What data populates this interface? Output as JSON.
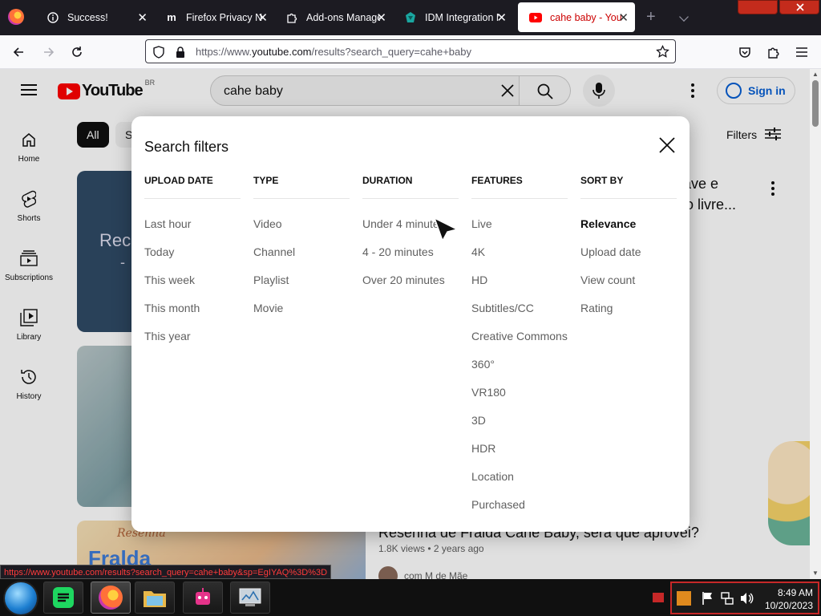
{
  "browser": {
    "tabs": [
      {
        "title": "Success!",
        "icon": "globe-icon",
        "active": false
      },
      {
        "title": "Firefox Privacy Ne",
        "icon": "mozilla-m-icon",
        "active": false
      },
      {
        "title": "Add-ons Manage",
        "icon": "puzzle-icon",
        "active": false
      },
      {
        "title": "IDM Integration M",
        "icon": "idm-icon",
        "active": false
      },
      {
        "title": "cahe baby - YouT",
        "icon": "youtube-icon",
        "active": true
      }
    ],
    "url_prefix": "https://www.",
    "url_domain": "youtube.com",
    "url_path": "/results?search_query=cahe+baby",
    "status_url": "https://www.youtube.com/results?search_query=cahe+baby&sp=EgIYAQ%3D%3D"
  },
  "youtube": {
    "logo_text": "YouTube",
    "country_code": "BR",
    "search_query": "cahe baby",
    "sign_in": "Sign in",
    "sidebar": [
      {
        "label": "Home",
        "icon": "home-icon"
      },
      {
        "label": "Shorts",
        "icon": "shorts-icon"
      },
      {
        "label": "Subscriptions",
        "icon": "subscriptions-icon"
      },
      {
        "label": "Library",
        "icon": "library-icon"
      },
      {
        "label": "History",
        "icon": "history-icon"
      }
    ],
    "chips": [
      "All",
      "S"
    ],
    "filters_label": "Filters",
    "results": {
      "r1_thumb_text": "Rec",
      "r1_thumb_text2": "-",
      "r1_title_line1": "ave e",
      "r1_title_line2": "uto livre...",
      "r3_thumb_line1": "Resenha",
      "r3_thumb_line2": "Fralda",
      "r3_title": "Resenha de Fralda Cahe Baby, será que aprovei?",
      "r3_meta": "1.8K views • 2 years ago",
      "r3_channel": "com M de Mãe"
    }
  },
  "modal": {
    "title": "Search filters",
    "columns": [
      {
        "heading": "UPLOAD DATE",
        "options": [
          "Last hour",
          "Today",
          "This week",
          "This month",
          "This year"
        ],
        "selected": null
      },
      {
        "heading": "TYPE",
        "options": [
          "Video",
          "Channel",
          "Playlist",
          "Movie"
        ],
        "selected": null
      },
      {
        "heading": "DURATION",
        "options": [
          "Under 4 minutes",
          "4 - 20 minutes",
          "Over 20 minutes"
        ],
        "selected": null
      },
      {
        "heading": "FEATURES",
        "options": [
          "Live",
          "4K",
          "HD",
          "Subtitles/CC",
          "Creative Commons",
          "360°",
          "VR180",
          "3D",
          "HDR",
          "Location",
          "Purchased"
        ],
        "selected": null
      },
      {
        "heading": "SORT BY",
        "options": [
          "Relevance",
          "Upload date",
          "View count",
          "Rating"
        ],
        "selected": "Relevance"
      }
    ]
  },
  "taskbar": {
    "apps": [
      "spotify-like-app-icon",
      "firefox-icon",
      "file-explorer-icon",
      "robot-app-icon",
      "system-monitor-icon"
    ],
    "time": "8:49 AM",
    "date": "10/20/2023"
  },
  "colors": {
    "youtube_red": "#ff0000",
    "link_blue": "#065fd4",
    "tray_border": "#c62828"
  }
}
